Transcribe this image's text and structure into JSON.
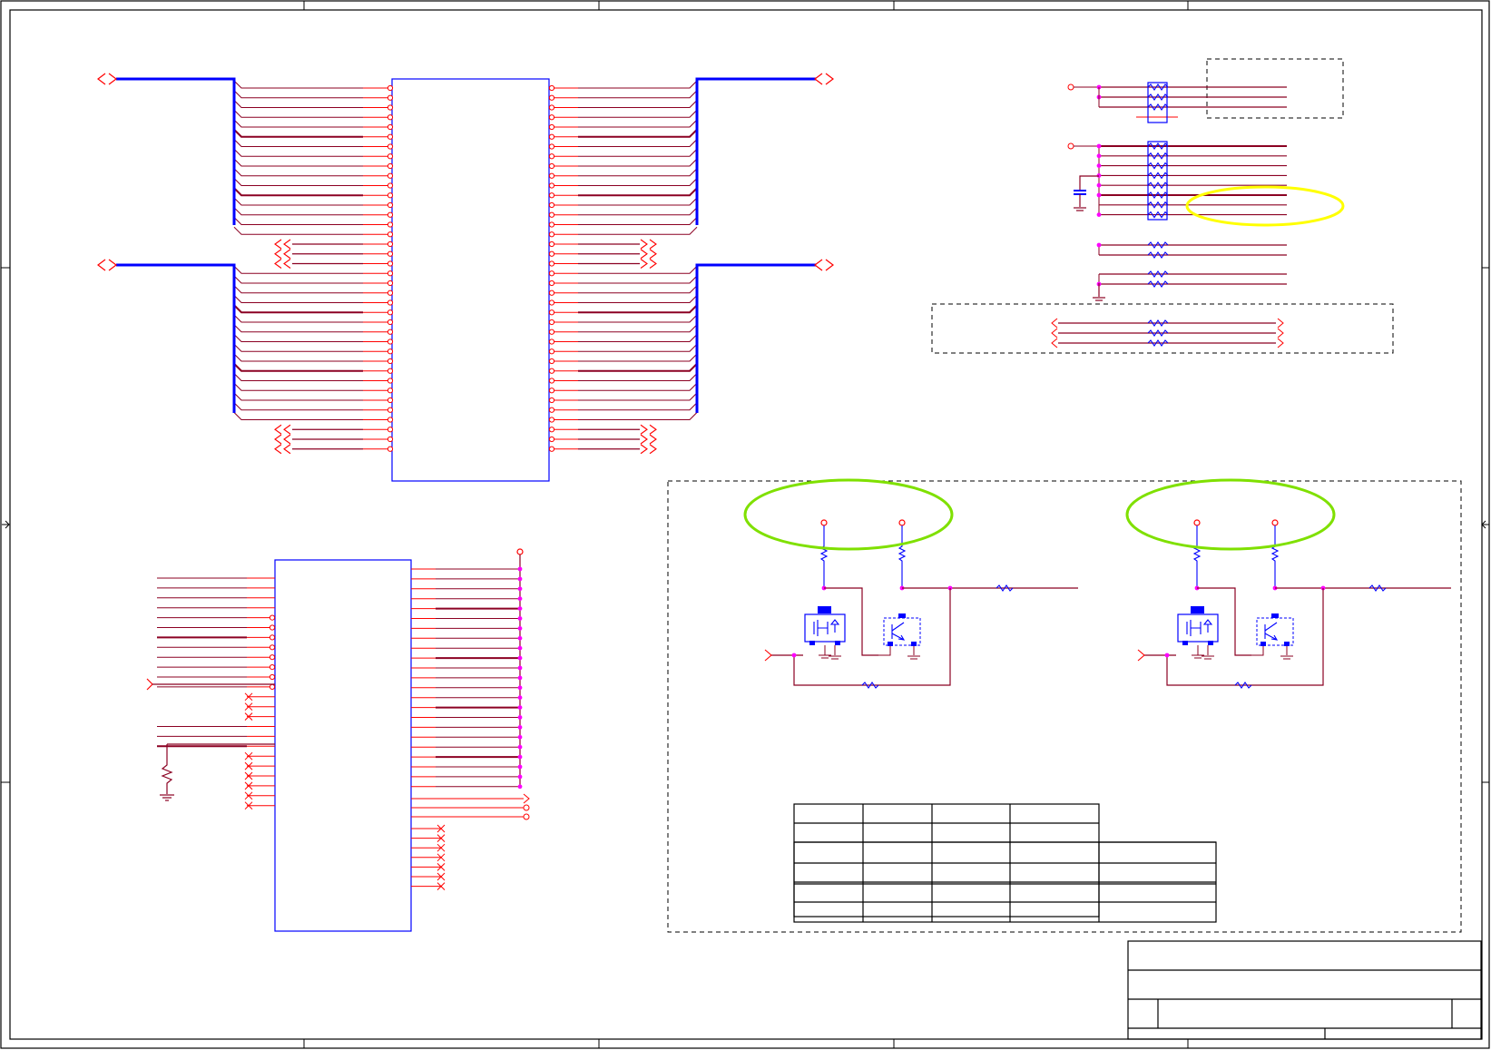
{
  "schematic": {
    "type": "circuit-schematic",
    "printed_text": [],
    "colors": {
      "border": "#000000",
      "component_outline": "#0000ff",
      "wire": "#8b0022",
      "pin": "#ff0000",
      "junction": "#ff00ff",
      "bus": "#0000ff",
      "highlight_yellow": "#ffff00",
      "highlight_green": "#7fe000",
      "dashed_box": "#000000"
    },
    "highlights": [
      {
        "name": "yellow-oval",
        "color": "#ffff00"
      },
      {
        "name": "green-oval-left",
        "color": "#7fe000"
      },
      {
        "name": "green-oval-right",
        "color": "#7fe000"
      }
    ],
    "icons": [
      "resistor-icon",
      "capacitor-icon",
      "ground-icon",
      "transistor-icon",
      "offpage-connector-icon",
      "bus-icon"
    ]
  }
}
